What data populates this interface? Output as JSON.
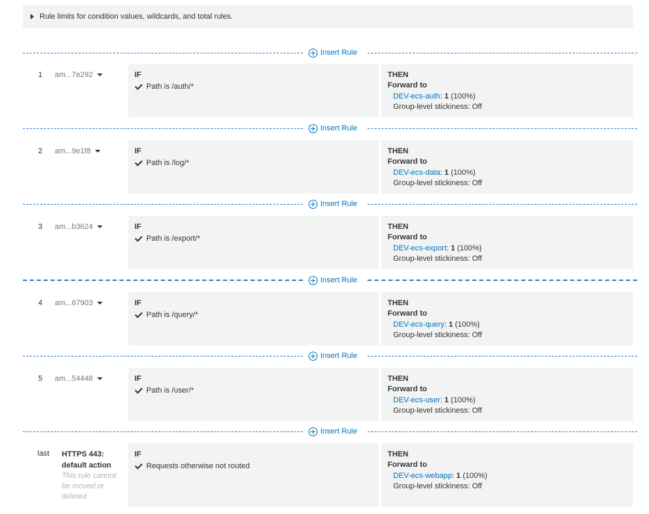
{
  "limits": {
    "text": "Rule limits for condition values, wildcards, and total rules."
  },
  "insert_label": "Insert Rule",
  "if_label": "IF",
  "then_label": "THEN",
  "forward_label": "Forward to",
  "rules": [
    {
      "num": "1",
      "arn": "am...7e292",
      "condition": "Path is /auth/*",
      "target": "DEV-ecs-auth",
      "weight": "1",
      "pct": "(100%)",
      "stickiness": "Group-level stickiness: Off"
    },
    {
      "num": "2",
      "arn": "am...9e1f8",
      "condition": "Path is /log/*",
      "target": "DEV-ecs-data",
      "weight": "1",
      "pct": "(100%)",
      "stickiness": "Group-level stickiness: Off"
    },
    {
      "num": "3",
      "arn": "am...b3624",
      "condition": "Path is /export/*",
      "target": "DEV-ecs-export",
      "weight": "1",
      "pct": "(100%)",
      "stickiness": "Group-level stickiness: Off"
    },
    {
      "num": "4",
      "arn": "am...67903",
      "condition": "Path is /query/*",
      "target": "DEV-ecs-query",
      "weight": "1",
      "pct": "(100%)",
      "stickiness": "Group-level stickiness: Off"
    },
    {
      "num": "5",
      "arn": "am...54448",
      "condition": "Path is /user/*",
      "target": "DEV-ecs-user",
      "weight": "1",
      "pct": "(100%)",
      "stickiness": "Group-level stickiness: Off"
    }
  ],
  "default_rule": {
    "num": "last",
    "title": "HTTPS 443: default action",
    "note": "This rule cannot be moved or deleted",
    "condition": "Requests otherwise not routed",
    "target": "DEV-ecs-webapp",
    "weight": "1",
    "pct": "(100%)",
    "stickiness": "Group-level stickiness: Off"
  },
  "colors": {
    "link": "#0073bb",
    "dash": "#2e7bcf",
    "panel": "#f2f3f3"
  },
  "icons": {
    "insert": "plus-circle-icon",
    "condition": "checkmark-icon",
    "expand": "caret-right-icon",
    "menu": "caret-down-icon"
  }
}
